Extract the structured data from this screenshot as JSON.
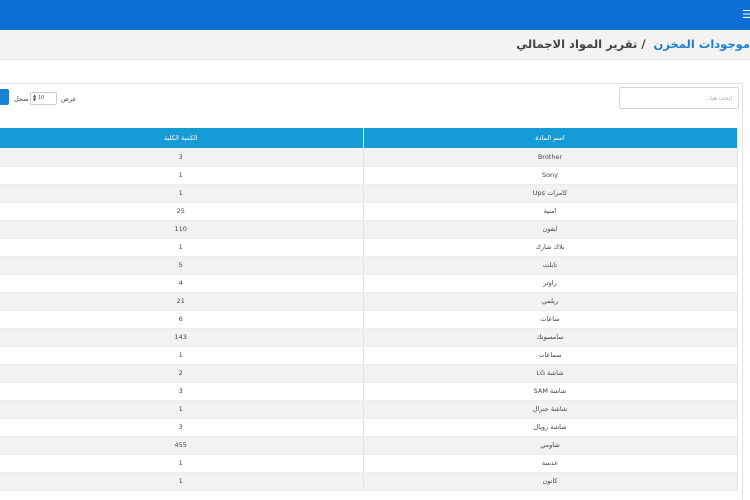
{
  "header": {
    "menu_icon": "menu-icon"
  },
  "breadcrumb": {
    "parent": "موجودات المخزن",
    "separator": " /",
    "current": "تقرير المواد الاجمالي"
  },
  "controls": {
    "search_placeholder": "ابحث هنا...",
    "show_label": "عرض",
    "page_length": "10",
    "records_label": "سجل"
  },
  "table": {
    "columns": {
      "name": "اسم المادة",
      "quantity": "الكمية الكلية"
    },
    "rows": [
      {
        "name": "Brother",
        "quantity": "3"
      },
      {
        "name": "Sony",
        "quantity": "1"
      },
      {
        "name": "كامرات Ups",
        "quantity": "1"
      },
      {
        "name": "امنية",
        "quantity": "25"
      },
      {
        "name": "ايفون",
        "quantity": "110"
      },
      {
        "name": "بلاك شارك",
        "quantity": "1"
      },
      {
        "name": "تابلت",
        "quantity": "5"
      },
      {
        "name": "راوتر",
        "quantity": "4"
      },
      {
        "name": "ريلمي",
        "quantity": "21"
      },
      {
        "name": "ساعات",
        "quantity": "6"
      },
      {
        "name": "سامسونك",
        "quantity": "143"
      },
      {
        "name": "سماعات",
        "quantity": "1"
      },
      {
        "name": "شاشة LG",
        "quantity": "2"
      },
      {
        "name": "شاشة SAM",
        "quantity": "3"
      },
      {
        "name": "شاشة جنرال",
        "quantity": "1"
      },
      {
        "name": "شاشة رويال",
        "quantity": "3"
      },
      {
        "name": "شاومي",
        "quantity": "455"
      },
      {
        "name": "عدسة",
        "quantity": "1"
      },
      {
        "name": "كانون",
        "quantity": "1"
      }
    ]
  },
  "colors": {
    "topbar": "#0d6fd6",
    "table_header": "#159bd6",
    "link": "#1f7fd1"
  }
}
